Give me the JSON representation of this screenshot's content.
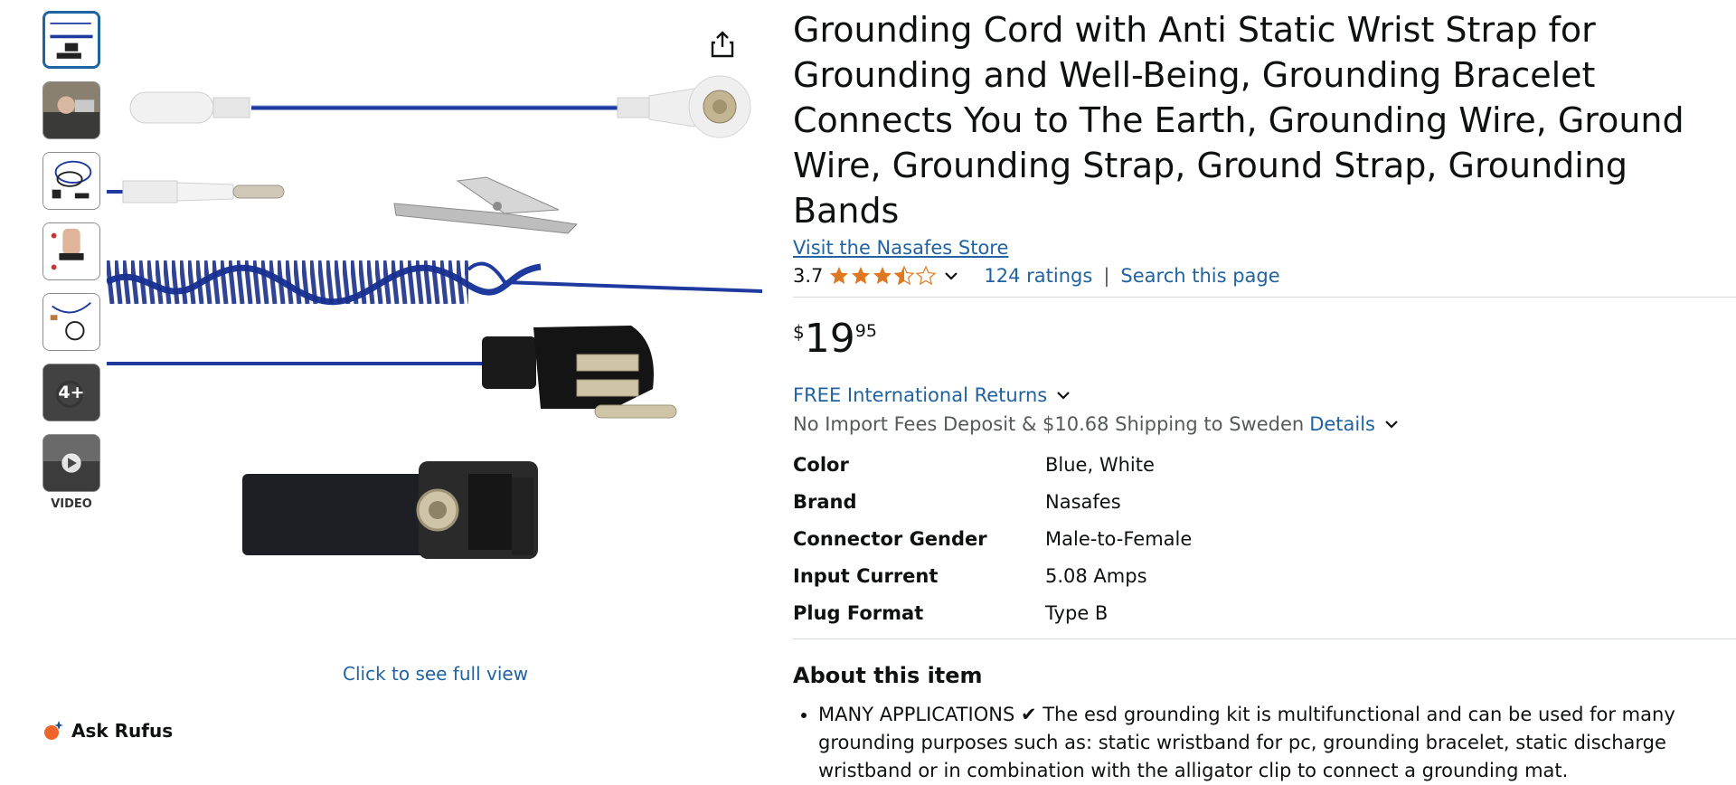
{
  "gallery": {
    "more_label": "4+",
    "video_label": "VIDEO",
    "full_view_label": "Click to see full view",
    "rufus_label": "Ask Rufus"
  },
  "product": {
    "title": "Grounding Cord with Anti Static Wrist Strap for Grounding and Well-Being, Grounding Bracelet Connects You to The Earth, Grounding Wire, Ground Wire, Grounding Strap, Ground Strap, Grounding Bands",
    "store_link": "Visit the Nasafes Store",
    "rating": "3.7",
    "rating_value": 3.7,
    "ratings_count": "124 ratings",
    "search_page": "Search this page",
    "separator": "|",
    "price": {
      "currency": "$",
      "whole": "19",
      "fraction": "95"
    },
    "returns": "FREE International Returns",
    "shipping": "No Import Fees Deposit & $10.68 Shipping to Sweden",
    "details_link": "Details"
  },
  "specs": [
    {
      "key": "Color",
      "value": "Blue, White"
    },
    {
      "key": "Brand",
      "value": "Nasafes"
    },
    {
      "key": "Connector Gender",
      "value": "Male-to-Female"
    },
    {
      "key": "Input Current",
      "value": "5.08 Amps"
    },
    {
      "key": "Plug Format",
      "value": "Type B"
    }
  ],
  "about": {
    "heading": "About this item",
    "bullets": [
      "MANY APPLICATIONS ✔ The esd grounding kit is multifunctional and can be used for many grounding purposes such as: static wristband for pc, grounding bracelet, static discharge wristband or in combination with the alligator clip to connect a grounding mat."
    ]
  },
  "colors": {
    "link": "#2162a1",
    "star": "#de7921",
    "text": "#0f1111",
    "muted": "#565959",
    "cord_blue": "#1f3a9e"
  }
}
